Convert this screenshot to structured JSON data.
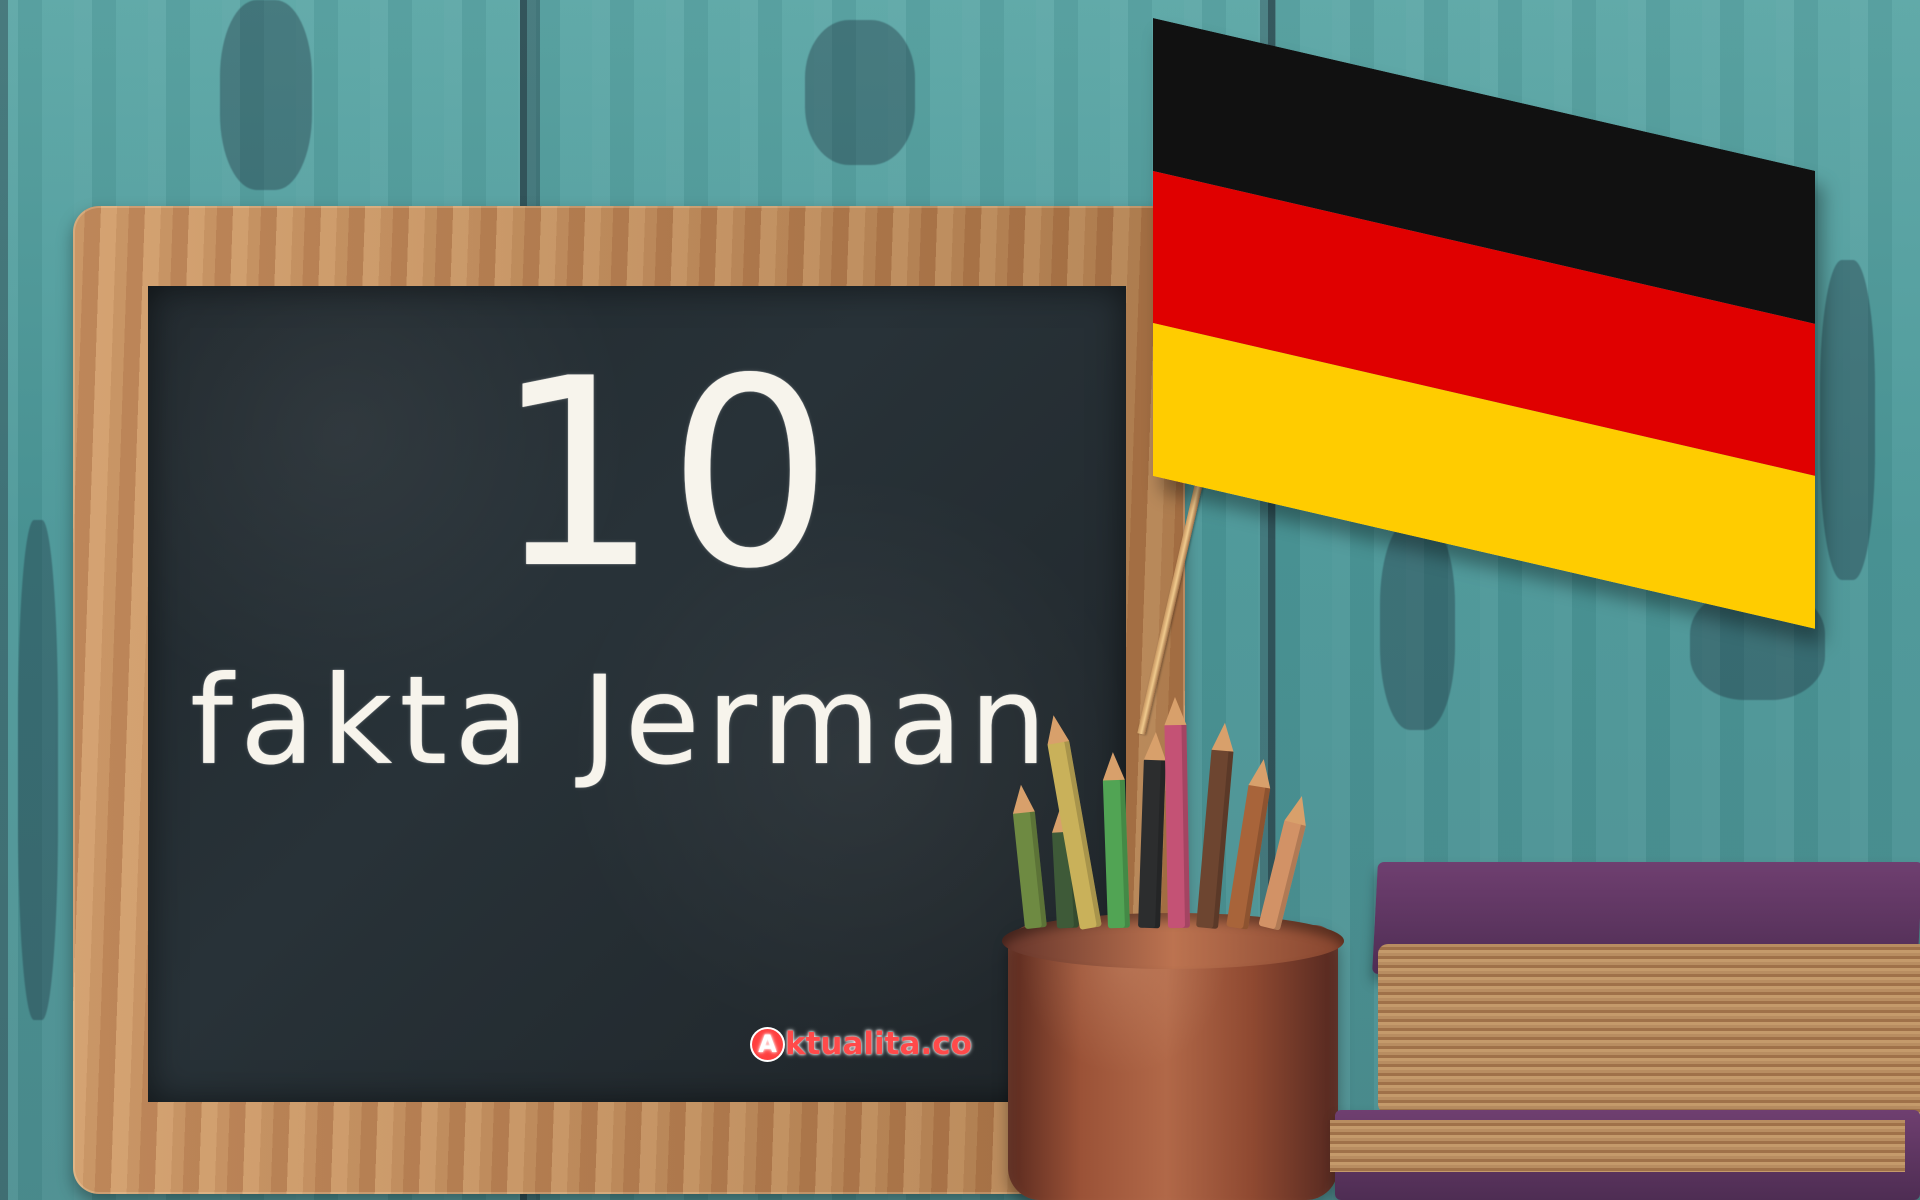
{
  "image": {
    "chalkboard": {
      "number": "10",
      "title": "fakta Jerman"
    },
    "watermark": {
      "badge": "A",
      "text": "ktualita.co"
    },
    "flag": {
      "colors": [
        "#111111",
        "#e00000",
        "#ffcc00"
      ]
    }
  }
}
